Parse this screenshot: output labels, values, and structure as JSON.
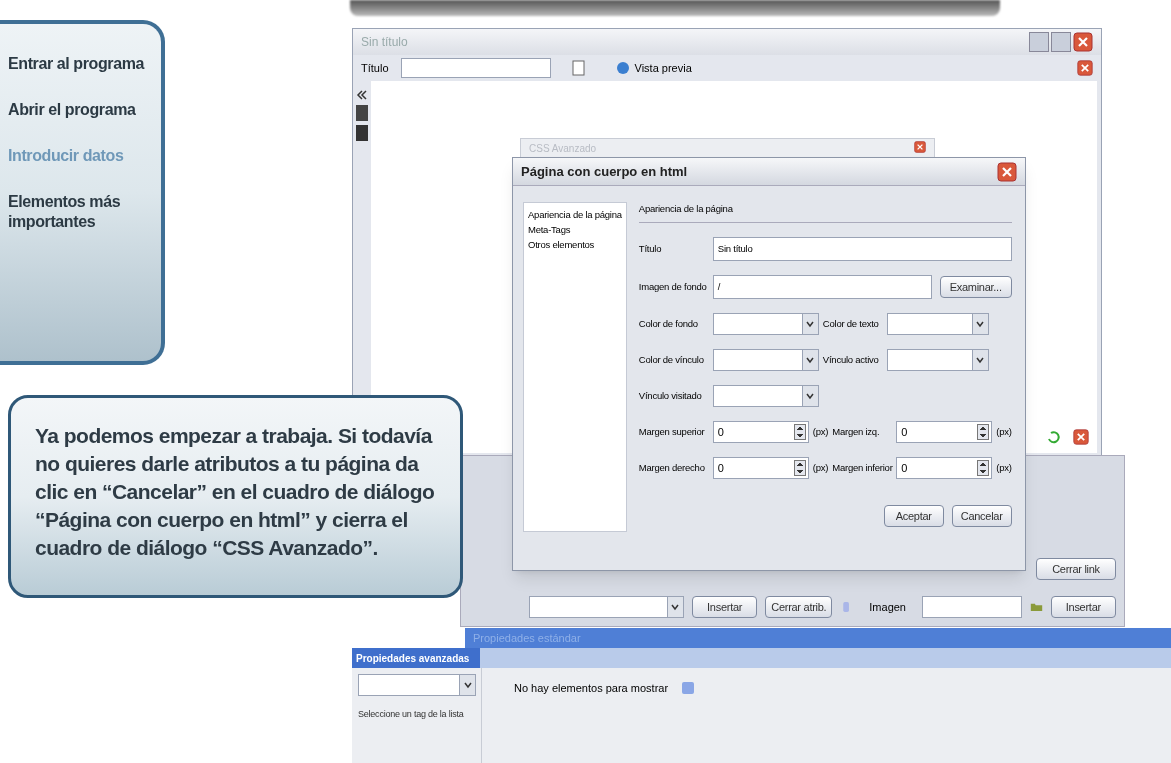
{
  "nav": {
    "items": [
      {
        "label": "Entrar al programa",
        "selected": false
      },
      {
        "label": "Abrir el programa",
        "selected": false
      },
      {
        "label": "Introducir datos",
        "selected": true
      },
      {
        "label": "Elementos más importantes",
        "selected": false
      }
    ]
  },
  "callout": {
    "text": "Ya podemos empezar a trabaja. Si todavía no quieres darle atributos a tu página da clic en “Cancelar” en el cuadro de diálogo “Página con cuerpo en html” y cierra el cuadro de diálogo “CSS Avanzado”."
  },
  "main_window": {
    "title": "Sin título",
    "title_label": "Título",
    "preview": "Vista previa"
  },
  "css_window": {
    "title": "CSS Avanzado"
  },
  "dialog": {
    "title": "Página con cuerpo en html",
    "sections": [
      {
        "label": "Apariencia de la página",
        "selected": false
      },
      {
        "label": "Meta-Tags",
        "selected": false
      },
      {
        "label": "Otros elementos",
        "selected": false
      }
    ],
    "heading": "Apariencia de la página",
    "title_row": {
      "label": "Título",
      "value": "Sin título"
    },
    "image_row": {
      "label": "Imagen de fondo",
      "value": "/",
      "button": "Examinar..."
    },
    "selects": [
      [
        {
          "label": "Color de fondo"
        },
        {
          "label": "Color de texto"
        }
      ],
      [
        {
          "label": "Color de vínculo"
        },
        {
          "label": "Vínculo activo"
        }
      ],
      [
        {
          "label": "Vínculo visitado"
        }
      ]
    ],
    "spins": [
      [
        {
          "label": "Margen superior",
          "value": "0",
          "unit": "(px)"
        },
        {
          "label": "Margen izq.",
          "value": "0",
          "unit": "(px)"
        }
      ],
      [
        {
          "label": "Margen derecho",
          "value": "0",
          "unit": "(px)"
        },
        {
          "label": "Margen inferior",
          "value": "0",
          "unit": "(px)"
        }
      ]
    ],
    "buttons": [
      "Aceptar",
      "Cancelar"
    ]
  },
  "back_panel": {
    "close_link": "Cerrar link",
    "insert": "Insertar",
    "close_attr": "Cerrar atrib.",
    "image_label": "Imagen",
    "insert_image": "Insertar"
  },
  "standard_bar": "Propiedades estándar",
  "advanced_bar": "Propiedades avanzadas",
  "advanced": {
    "hint": "Seleccione un tag de la lista",
    "empty": "No hay elementos para mostrar"
  }
}
